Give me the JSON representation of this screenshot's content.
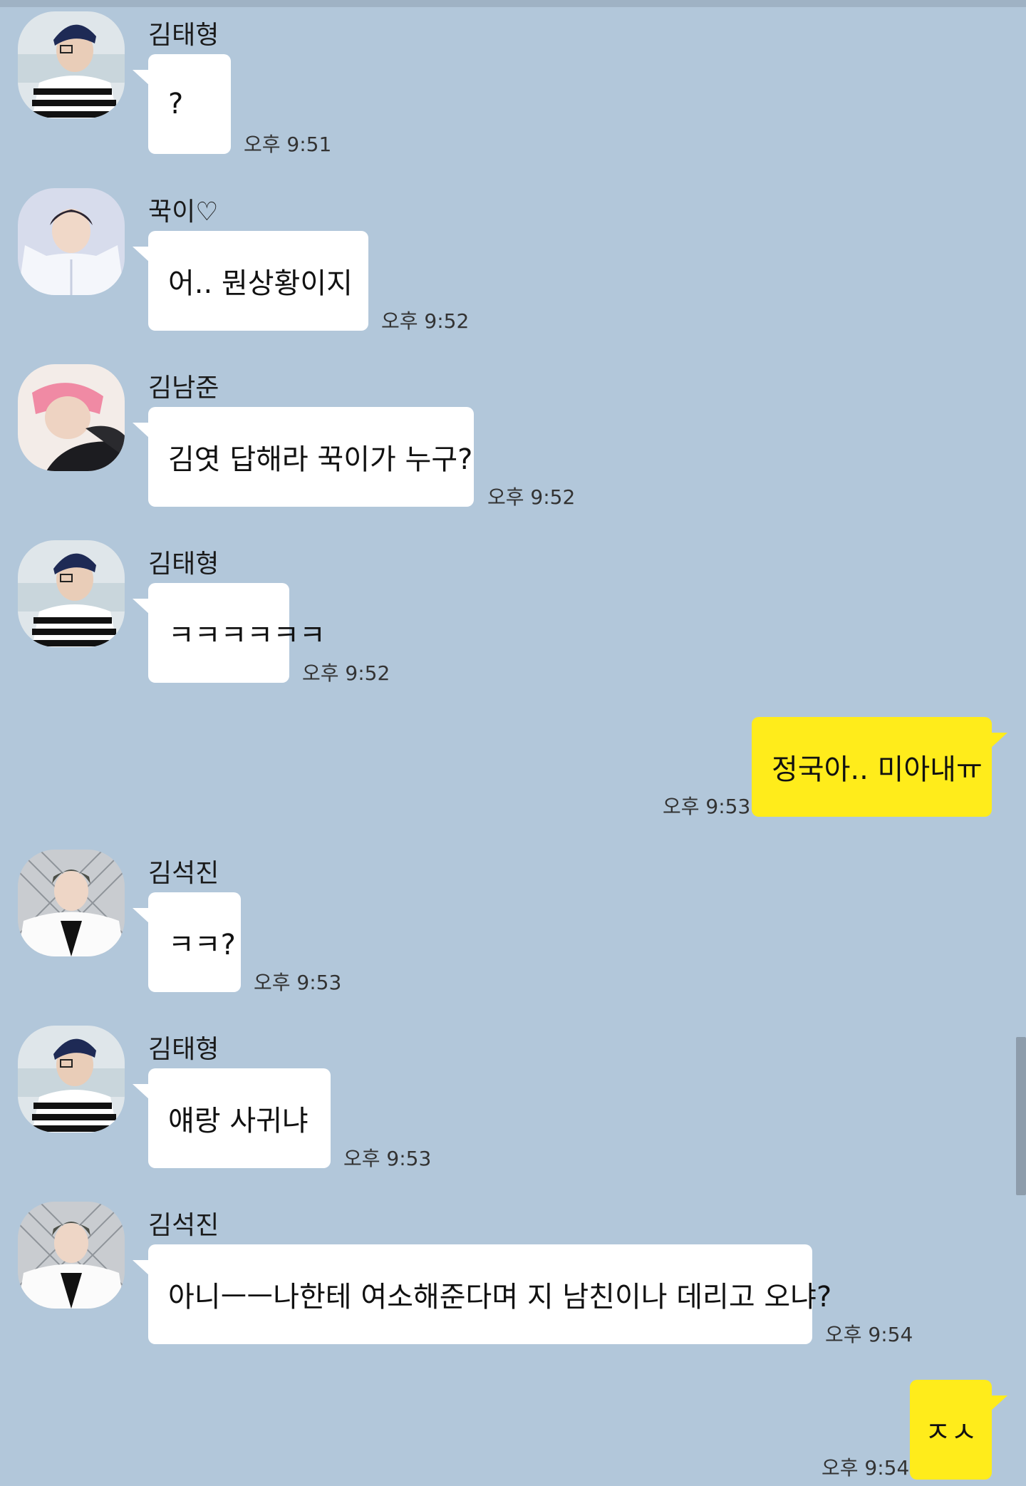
{
  "messages": [
    {
      "sender": "김태형",
      "text": "?",
      "time": "오후 9:51",
      "avatar": "avatar-taehyung-icon"
    },
    {
      "sender": "꾹이♡",
      "text": "어.. 뭔상황이지",
      "time": "오후 9:52",
      "avatar": "avatar-kook-icon"
    },
    {
      "sender": "김남준",
      "text": "김엿 답해라 꾹이가 누구?",
      "time": "오후 9:52",
      "avatar": "avatar-namjoon-icon"
    },
    {
      "sender": "김태형",
      "text": "ㅋㅋㅋㅋㅋㅋ",
      "time": "오후 9:52",
      "avatar": "avatar-taehyung-icon"
    },
    {
      "text": "정국아.. 미아내ㅠ",
      "time": "오후 9:53"
    },
    {
      "sender": "김석진",
      "text": "ㅋㅋ?",
      "time": "오후 9:53",
      "avatar": "avatar-seokjin-icon"
    },
    {
      "sender": "김태형",
      "text": "얘랑 사귀냐",
      "time": "오후 9:53",
      "avatar": "avatar-taehyung-icon"
    },
    {
      "sender": "김석진",
      "text": "아니ㅡㅡ나한테 여소해준다며 지 남친이나 데리고 오냐?",
      "time": "오후 9:54",
      "avatar": "avatar-seokjin-icon"
    },
    {
      "text": "ㅈㅅ",
      "time": "오후 9:54"
    }
  ],
  "colors": {
    "background": "#b2c7da",
    "incoming_bubble": "#ffffff",
    "outgoing_bubble": "#ffec1b"
  }
}
